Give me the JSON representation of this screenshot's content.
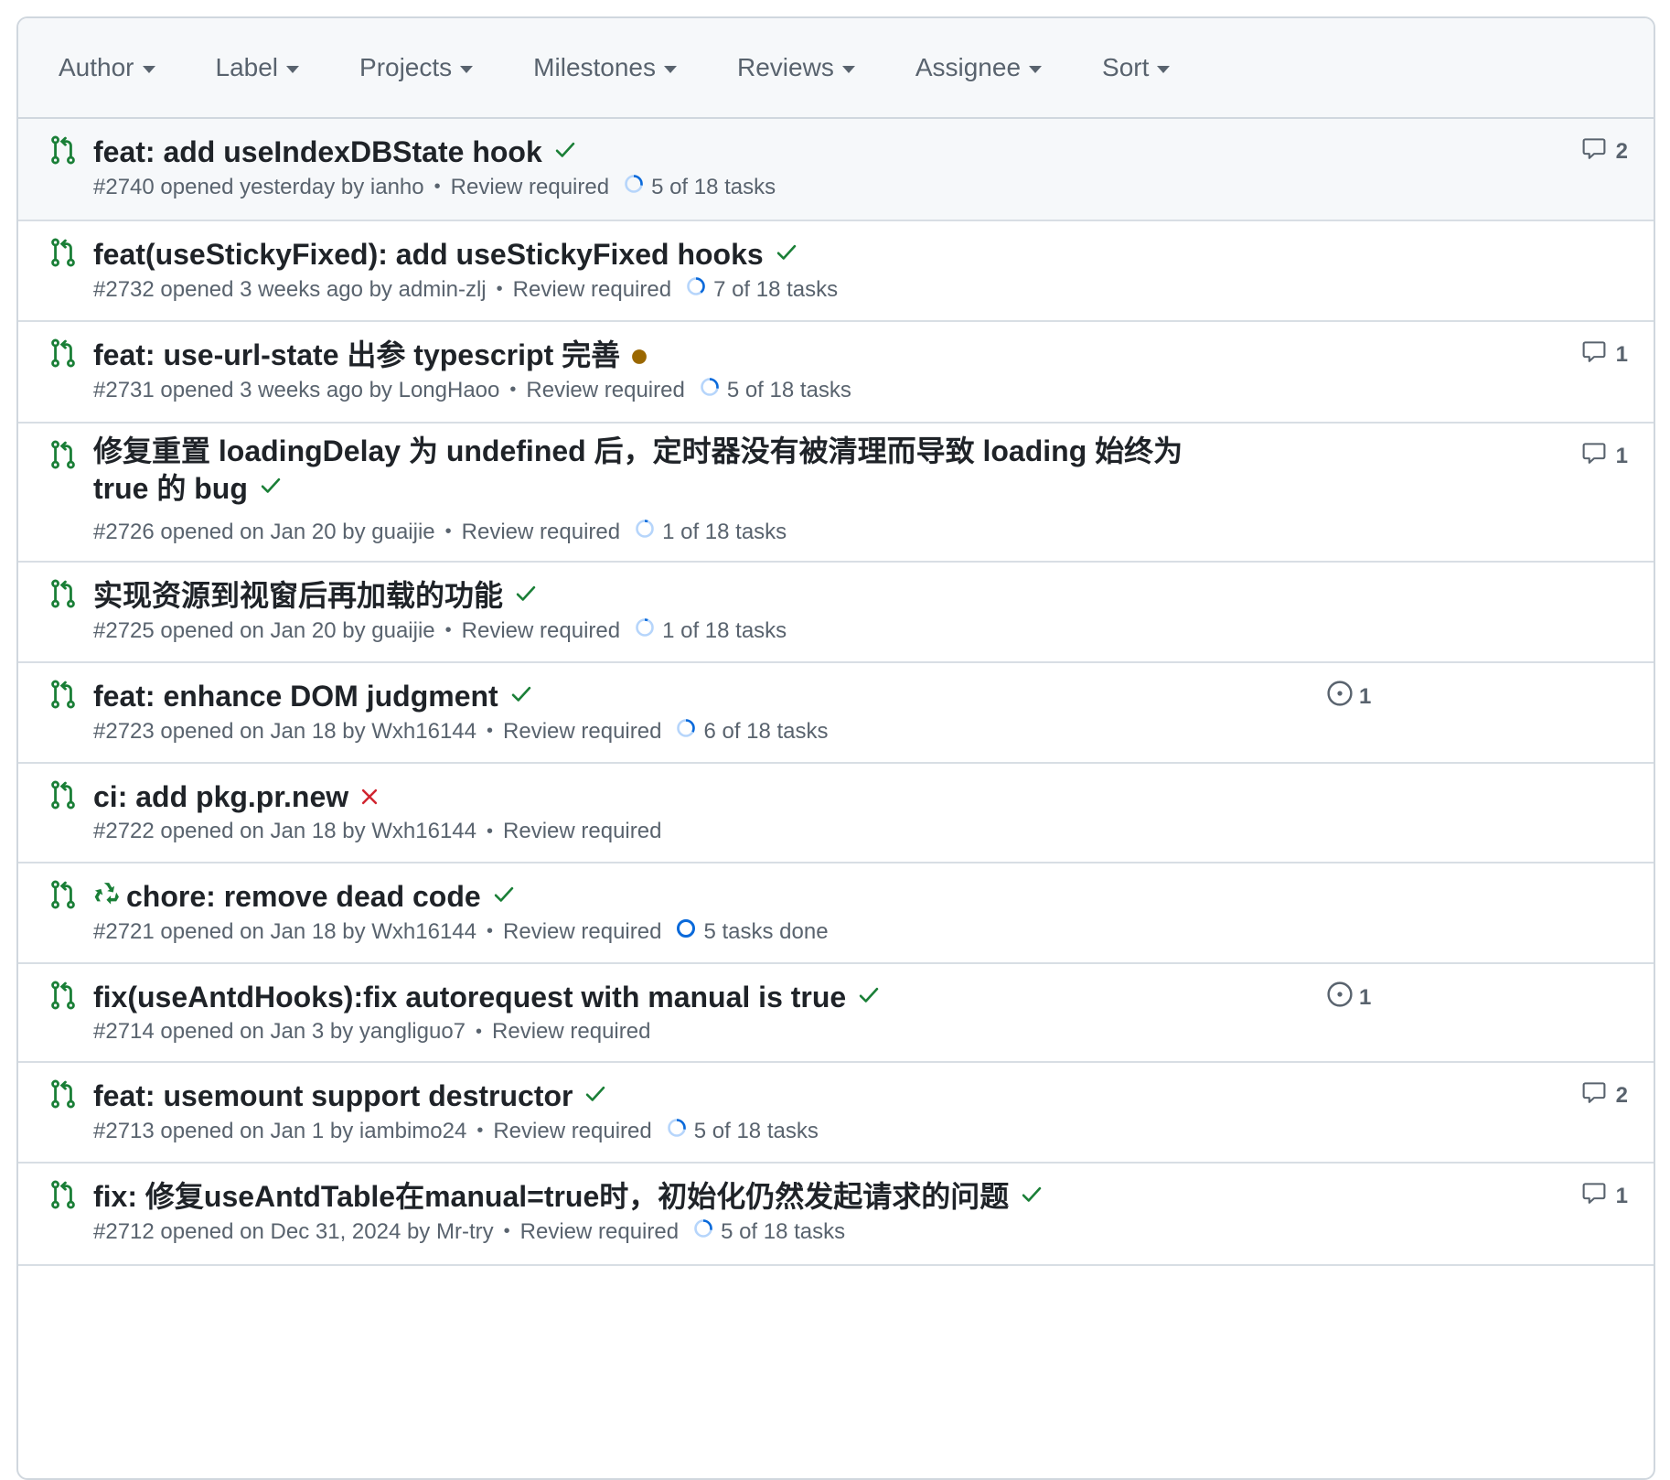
{
  "filters": [
    "Author",
    "Label",
    "Projects",
    "Milestones",
    "Reviews",
    "Assignee",
    "Sort"
  ],
  "colors": {
    "open_green": "#1a7f37",
    "fail_red": "#d1242f",
    "pending_yellow": "#9a6700",
    "progress_blue": "#0969da",
    "muted": "#59636e"
  },
  "pull_requests": [
    {
      "title": "feat: add useIndexDBState hook",
      "status": "success",
      "meta": "#2740 opened yesterday by ianho",
      "review": "Review required",
      "tasks": "5 of 18 tasks",
      "task_fraction": 0.28,
      "comments": "2",
      "linked": ""
    },
    {
      "title": "feat(useStickyFixed): add useStickyFixed hooks",
      "status": "success",
      "meta": "#2732 opened 3 weeks ago by admin-zlj",
      "review": "Review required",
      "tasks": "7 of 18 tasks",
      "task_fraction": 0.39,
      "comments": "",
      "linked": ""
    },
    {
      "title": "feat: use-url-state 出参 typescript 完善",
      "status": "pending",
      "meta": "#2731 opened 3 weeks ago by LongHaoo",
      "review": "Review required",
      "tasks": "5 of 18 tasks",
      "task_fraction": 0.28,
      "comments": "1",
      "linked": ""
    },
    {
      "title": "修复重置 loadingDelay 为 undefined 后，定时器没有被清理而导致 loading 始终为 true 的 bug",
      "status": "success",
      "meta": "#2726 opened on Jan 20 by guaijie",
      "review": "Review required",
      "tasks": "1 of 18 tasks",
      "task_fraction": 0.06,
      "comments": "1",
      "linked": ""
    },
    {
      "title": "实现资源到视窗后再加载的功能",
      "status": "success",
      "meta": "#2725 opened on Jan 20 by guaijie",
      "review": "Review required",
      "tasks": "1 of 18 tasks",
      "task_fraction": 0.06,
      "comments": "",
      "linked": ""
    },
    {
      "title": "feat: enhance DOM judgment",
      "status": "success",
      "meta": "#2723 opened on Jan 18 by Wxh16144",
      "review": "Review required",
      "tasks": "6 of 18 tasks",
      "task_fraction": 0.33,
      "comments": "",
      "linked": "1"
    },
    {
      "title": "ci: add pkg.pr.new",
      "status": "failure",
      "meta": "#2722 opened on Jan 18 by Wxh16144",
      "review": "Review required",
      "tasks": "",
      "task_fraction": 0,
      "comments": "",
      "linked": ""
    },
    {
      "title": "chore: remove dead code",
      "emoji": "recycle-emoji",
      "status": "success",
      "meta": "#2721 opened on Jan 18 by Wxh16144",
      "review": "Review required",
      "tasks": "5 tasks done",
      "task_fraction": 1,
      "comments": "",
      "linked": ""
    },
    {
      "title": "fix(useAntdHooks):fix autorequest with manual is true",
      "status": "success",
      "meta": "#2714 opened on Jan 3 by yangliguo7",
      "review": "Review required",
      "tasks": "",
      "task_fraction": 0,
      "comments": "",
      "linked": "1"
    },
    {
      "title": "feat: usemount support destructor",
      "status": "success",
      "meta": "#2713 opened on Jan 1 by iambimo24",
      "review": "Review required",
      "tasks": "5 of 18 tasks",
      "task_fraction": 0.28,
      "comments": "2",
      "linked": ""
    },
    {
      "title": "fix: 修复useAntdTable在manual=true时，初始化仍然发起请求的问题",
      "status": "success",
      "meta": "#2712 opened on Dec 31, 2024 by Mr-try",
      "review": "Review required",
      "tasks": "5 of 18 tasks",
      "task_fraction": 0.28,
      "comments": "1",
      "linked": ""
    }
  ]
}
